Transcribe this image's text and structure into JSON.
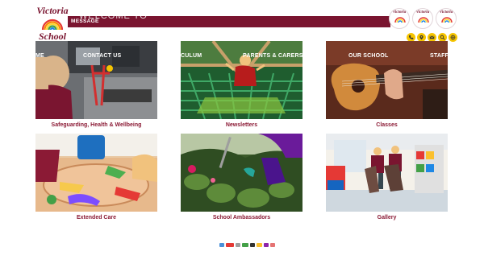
{
  "header": {
    "welcome": "WELCOME TO",
    "message": "MESSAGE",
    "logo_top": "Victoria",
    "logo_bottom": "School",
    "badges": [
      {
        "text": "Victoria"
      },
      {
        "text": "Victoria"
      },
      {
        "text": "Victoria"
      }
    ],
    "quick_icons": [
      "phone-icon",
      "location-pin-icon",
      "email-icon",
      "search-icon",
      "translate-icon"
    ]
  },
  "nav": {
    "items": [
      "ME",
      "CONTACT US",
      "CULUM",
      "PARENTS & CARERS INFO",
      "OUR SCHOOL",
      "STAFF"
    ]
  },
  "tiles": [
    {
      "label": "Safeguarding, Health & Wellbeing"
    },
    {
      "label": "Newsletters"
    },
    {
      "label": "Classes"
    },
    {
      "label": "Extended Care"
    },
    {
      "label": "School Ambassadors"
    },
    {
      "label": "Gallery"
    }
  ],
  "colors": {
    "brand": "#7a1530",
    "label": "#8b1a35",
    "accent_yellow": "#f5c400"
  }
}
